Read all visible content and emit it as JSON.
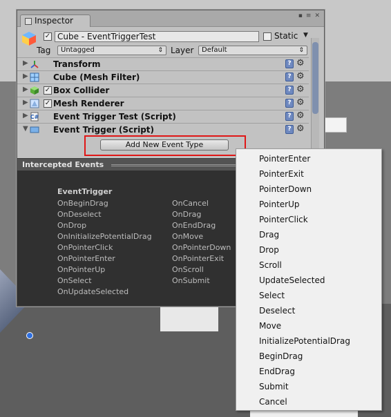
{
  "window": {
    "tab_label": "Inspector",
    "controls": [
      "▪",
      "≡",
      "✕"
    ]
  },
  "header": {
    "object_name": "Cube - EventTriggerTest",
    "active_checked": true,
    "static_label": "Static",
    "static_checked": false,
    "tag_label": "Tag",
    "tag_value": "Untagged",
    "layer_label": "Layer",
    "layer_value": "Default"
  },
  "components": [
    {
      "name": "Transform",
      "has_checkbox": false,
      "icon": "transform-icon",
      "expanded": false
    },
    {
      "name": "Cube (Mesh Filter)",
      "has_checkbox": false,
      "icon": "mesh-filter-icon",
      "expanded": false
    },
    {
      "name": "Box Collider",
      "has_checkbox": true,
      "icon": "box-collider-icon",
      "expanded": false
    },
    {
      "name": "Mesh Renderer",
      "has_checkbox": true,
      "icon": "mesh-renderer-icon",
      "expanded": false
    },
    {
      "name": "Event Trigger Test (Script)",
      "has_checkbox": true,
      "icon": "script-icon",
      "expanded": false
    },
    {
      "name": "Event Trigger (Script)",
      "has_checkbox": false,
      "icon": "script-icon",
      "expanded": true
    }
  ],
  "add_button_label": "Add New Event Type",
  "intercepted": {
    "title": "Intercepted Events",
    "class_name": "EventTrigger",
    "column1": [
      "OnBeginDrag",
      "OnDeselect",
      "OnDrop",
      "OnInitializePotentialDrag",
      "OnPointerClick",
      "OnPointerEnter",
      "OnPointerUp",
      "OnSelect",
      "OnUpdateSelected"
    ],
    "column2": [
      "OnCancel",
      "OnDrag",
      "OnEndDrag",
      "OnMove",
      "OnPointerDown",
      "OnPointerExit",
      "OnScroll",
      "OnSubmit"
    ]
  },
  "menu": {
    "items": [
      "PointerEnter",
      "PointerExit",
      "PointerDown",
      "PointerUp",
      "PointerClick",
      "Drag",
      "Drop",
      "Scroll",
      "UpdateSelected",
      "Select",
      "Deselect",
      "Move",
      "InitializePotentialDrag",
      "BeginDrag",
      "EndDrag",
      "Submit",
      "Cancel"
    ]
  },
  "colors": {
    "highlight_box": "#e01616",
    "events_panel": "#303030",
    "help_icon": "#6f89c0"
  }
}
